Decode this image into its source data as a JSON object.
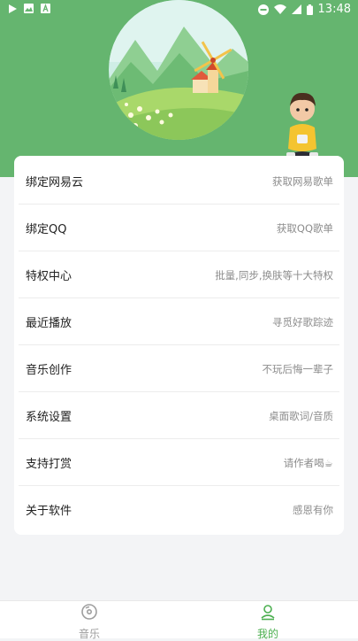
{
  "status_bar": {
    "time": "13:48",
    "left_icons": [
      "play-icon",
      "image-icon",
      "font-icon"
    ],
    "right_icons": [
      "do-not-disturb-icon",
      "wifi-icon",
      "signal-icon",
      "battery-icon"
    ]
  },
  "colors": {
    "header_green": "#65b56f",
    "accent_green": "#4caf50",
    "inactive_gray": "#9e9e9e"
  },
  "menu": [
    {
      "title": "绑定网易云",
      "desc": "获取网易歌单"
    },
    {
      "title": "绑定QQ",
      "desc": "获取QQ歌单"
    },
    {
      "title": "特权中心",
      "desc": "批量,同步,换肤等十大特权"
    },
    {
      "title": "最近播放",
      "desc": "寻觅好歌踪迹"
    },
    {
      "title": "音乐创作",
      "desc": "不玩后悔一辈子"
    },
    {
      "title": "系统设置",
      "desc": "桌面歌词/音质"
    },
    {
      "title": "支持打赏",
      "desc": "请作者喝☕"
    },
    {
      "title": "关于软件",
      "desc": "感恩有你"
    }
  ],
  "bottom_nav": {
    "music": {
      "label": "音乐",
      "icon": "music-disc-icon",
      "active": false
    },
    "mine": {
      "label": "我的",
      "icon": "user-icon",
      "active": true
    }
  }
}
